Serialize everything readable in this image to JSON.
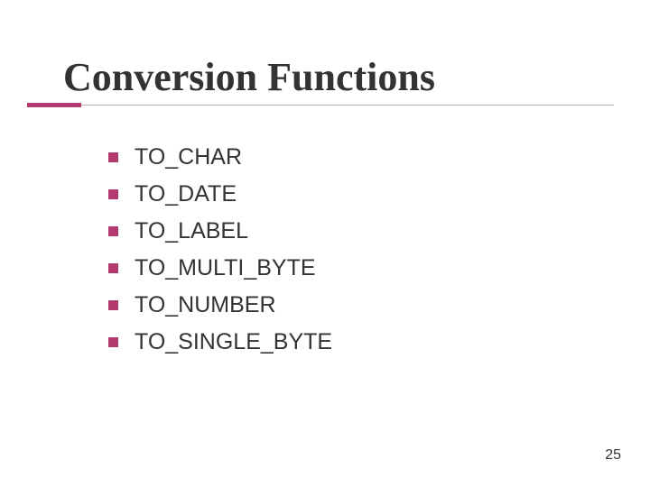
{
  "slide": {
    "title": "Conversion Functions",
    "items": [
      "TO_CHAR",
      "TO_DATE",
      "TO_LABEL",
      "TO_MULTI_BYTE",
      "TO_NUMBER",
      "TO_SINGLE_BYTE"
    ],
    "page_number": "25"
  }
}
